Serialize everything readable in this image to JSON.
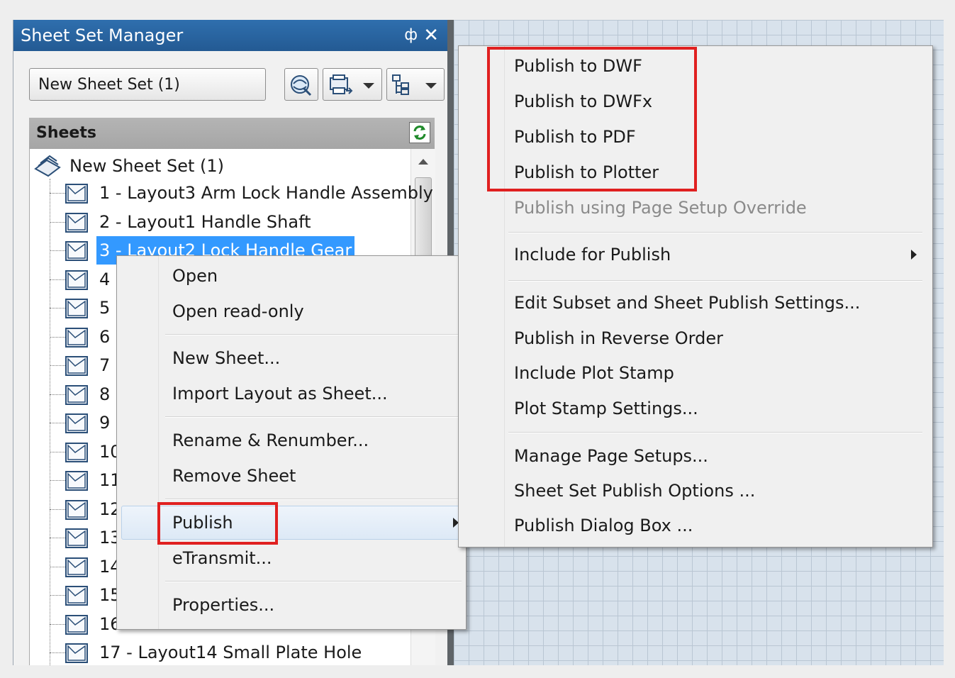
{
  "panel": {
    "title": "Sheet Set Manager",
    "pin_glyph": "ф",
    "close_glyph": "✕",
    "combo_value": "New Sheet Set (1)",
    "sheets_header": "Sheets",
    "root_label": "New Sheet Set (1)",
    "rows": [
      "1 - Layout3 Arm Lock Handle Assembly",
      "2 - Layout1 Handle Shaft",
      "3 - Layout2 Lock Handle Gear",
      "4 -",
      "5 -",
      "6 -",
      "7 -",
      "8 -",
      "9 -",
      "10",
      "11",
      "12",
      "13",
      "14",
      "15",
      "16",
      "17 - Layout14 Small Plate Hole"
    ],
    "icons": [
      "pin-icon",
      "close-icon",
      "publish-icon",
      "publish-dropdown-icon",
      "view-icon",
      "refresh-icon",
      "sheet-set-icon",
      "sheet-icon"
    ]
  },
  "context_menu": {
    "open": "Open",
    "open_read_only": "Open read-only",
    "new_sheet": "New Sheet...",
    "import_layout": "Import Layout as Sheet...",
    "rename_renumber": "Rename & Renumber...",
    "remove_sheet": "Remove Sheet",
    "publish": "Publish",
    "etransmit": "eTransmit...",
    "properties": "Properties..."
  },
  "publish_menu": {
    "dwf": "Publish to DWF",
    "dwfx": "Publish to DWFx",
    "pdf": "Publish to PDF",
    "plotter": "Publish to Plotter",
    "page_setup_override": "Publish using Page Setup Override",
    "include_for_publish": "Include for Publish",
    "edit_subset": "Edit Subset and Sheet Publish Settings...",
    "reverse_order": "Publish in Reverse Order",
    "plot_stamp": "Include Plot Stamp",
    "plot_stamp_settings": "Plot Stamp Settings...",
    "manage_page_setups": "Manage Page Setups...",
    "publish_options": "Sheet Set Publish Options ...",
    "dialog_box": "Publish Dialog Box ..."
  },
  "colors": {
    "title_bar": "#2f6fae",
    "selection": "#3399ff",
    "highlight_box": "#e02020"
  }
}
